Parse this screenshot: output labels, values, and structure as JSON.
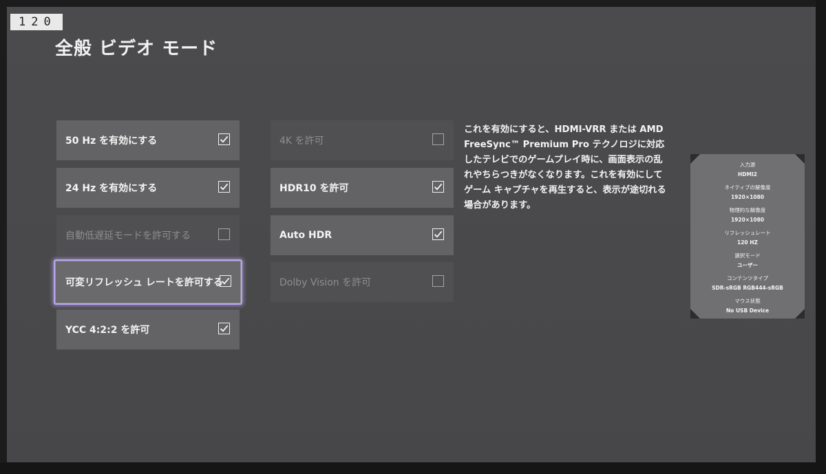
{
  "fps_counter": "120",
  "page": {
    "title": "全般 ビデオ モード"
  },
  "left_options": [
    {
      "label": "50 Hz を有効にする",
      "checked": true,
      "enabled": true
    },
    {
      "label": "24 Hz を有効にする",
      "checked": true,
      "enabled": true
    },
    {
      "label": "自動低遅延モードを許可する",
      "checked": false,
      "enabled": false
    },
    {
      "label": "可変リフレッシュ レートを許可する",
      "checked": true,
      "enabled": true,
      "focused": true
    },
    {
      "label": "YCC 4:2:2 を許可",
      "checked": true,
      "enabled": true
    }
  ],
  "right_options": [
    {
      "label": "4K を許可",
      "checked": false,
      "enabled": false
    },
    {
      "label": "HDR10 を許可",
      "checked": true,
      "enabled": true
    },
    {
      "label": "Auto HDR",
      "checked": true,
      "enabled": true
    },
    {
      "label": "Dolby Vision を許可",
      "checked": false,
      "enabled": false
    }
  ],
  "description": {
    "lines": [
      "これを有効にすると、HDMI-VRR または AMD",
      "FreeSync™ Premium Pro テクノロジに対応",
      "したテレビでのゲームプレイ時に、画面表示の乱",
      "れやちらつきがなくなります。これを有効にして",
      "ゲーム キャプチャを再生すると、表示が途切れる",
      "場合があります。"
    ]
  },
  "info_panel": {
    "items": [
      {
        "label": "入力源",
        "value": "HDMI2"
      },
      {
        "label": "ネイティブの解像度",
        "value": "1920×1080"
      },
      {
        "label": "物理的な解像度",
        "value": "1920×1080"
      },
      {
        "label": "リフレッシュレート",
        "value": "120 HZ"
      },
      {
        "label": "選択モード",
        "value": "ユーザー"
      },
      {
        "label": "コンテンツタイプ",
        "value": "SDR-sRGB RGB444-sRGB"
      },
      {
        "label": "マウス状態",
        "value": "No USB Device"
      }
    ]
  },
  "colors": {
    "background": "#4a4a4c",
    "option_enabled": "#636365",
    "option_disabled": "#505052",
    "focus_ring": "#b9a6f0",
    "text": "#f4f4f4",
    "text_disabled": "#8e8e90"
  },
  "icons": {
    "checked": "checkmark-icon",
    "unchecked": "empty-checkbox-icon"
  }
}
